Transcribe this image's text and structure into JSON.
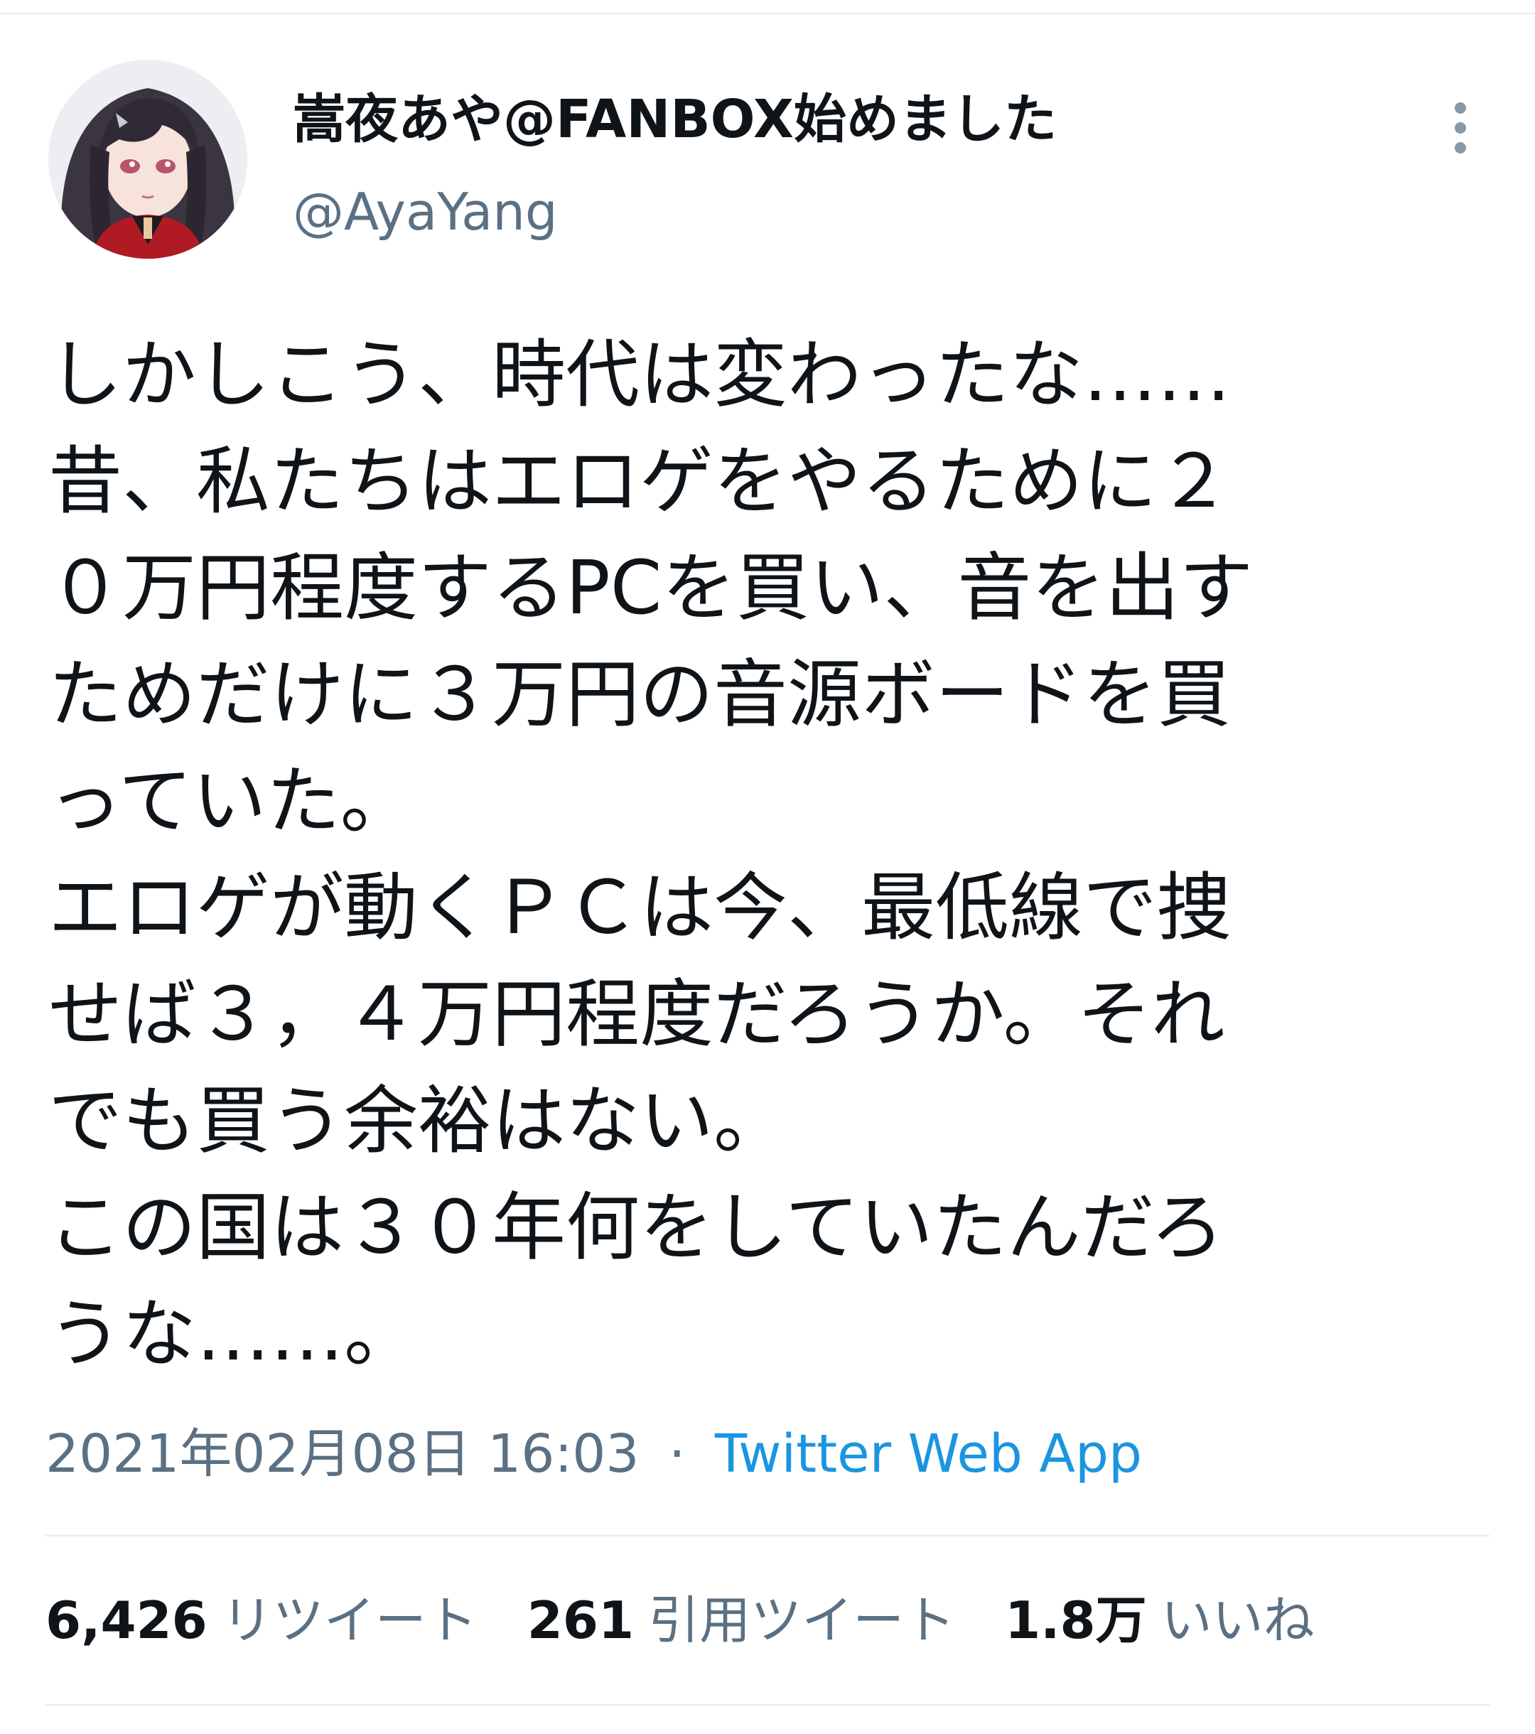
{
  "tweet": {
    "author": {
      "display_name": "嵩夜あや@FANBOX始めました",
      "handle": "@AyaYang"
    },
    "text_lines": [
      "しかしこう、時代は変わったな……",
      "昔、私たちはエロゲをやるために２",
      "０万円程度するPCを買い、音を出す",
      "ためだけに３万円の音源ボードを買",
      "っていた。",
      "エロゲが動くＰＣは今、最低線で捜",
      "せば３，４万円程度だろうか。それ",
      "でも買う余裕はない。",
      "この国は３０年何をしていたんだろ",
      "うな……。"
    ],
    "timestamp": "2021年02月08日 16:03",
    "separator": "·",
    "source": "Twitter Web App",
    "stats": [
      {
        "count": "6,426",
        "label": "リツイート"
      },
      {
        "count": "261",
        "label": "引用ツイート"
      },
      {
        "count": "1.8万",
        "label": "いいね"
      }
    ]
  },
  "colors": {
    "text": "#0f1419",
    "secondary": "#5b7083",
    "link": "#1b95e0",
    "divider": "#e6ecf0"
  },
  "icons": {
    "more": "more-vertical-icon"
  }
}
